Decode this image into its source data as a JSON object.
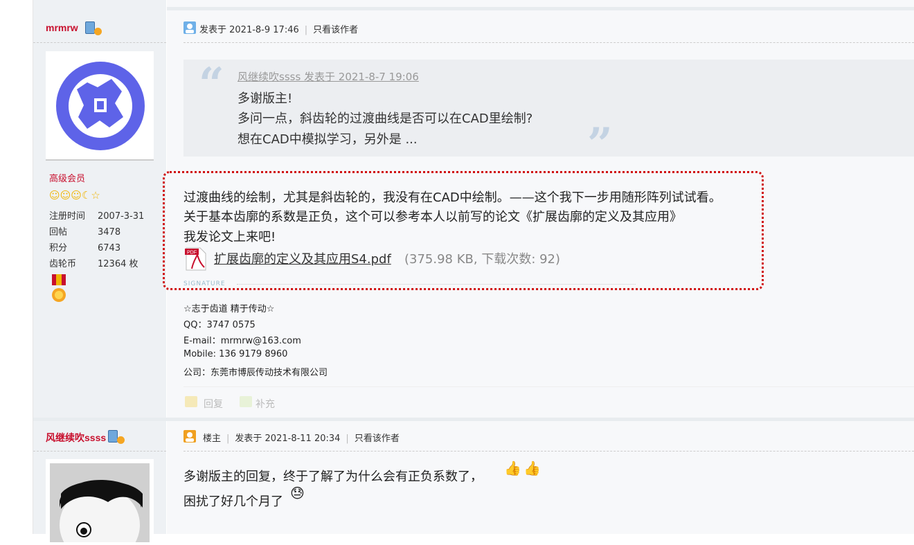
{
  "post1": {
    "username": "mrmrw",
    "rank": "高级会员",
    "stats": [
      {
        "key": "注册时间",
        "value": "2007-3-31"
      },
      {
        "key": "回帖",
        "value": "3478"
      },
      {
        "key": "积分",
        "value": "6743"
      },
      {
        "key": "齿轮币",
        "value": "12364 枚"
      }
    ],
    "posted_at": "发表于 2021-8-9 17:46",
    "only_author": "只看该作者",
    "quote": {
      "header": "风继续吹ssss 发表于 2021-8-7 19:06",
      "lines": [
        "多谢版主!",
        "多问一点，斜齿轮的过渡曲线是否可以在CAD里绘制?",
        "想在CAD中模拟学习，另外是 ..."
      ]
    },
    "body_lines": [
      "过渡曲线的绘制，尤其是斜齿轮的，我没有在CAD中绘制。——这个我下一步用随形阵列试试看。",
      "关于基本齿廓的系数是正负，这个可以参考本人以前写的论文《扩展齿廓的定义及其应用》",
      "我发论文上来吧!"
    ],
    "attachment": {
      "name": "扩展齿廓的定义及其应用S4.pdf",
      "meta": "(375.98 KB, 下载次数: 92)",
      "icon": "pdf-icon"
    },
    "signature_label": "SIGNATURE",
    "signature_lines": [
      "☆志于齿道 精于传动☆",
      "QQ：3747 0575",
      "E-mail：mrmrw@163.com",
      "Mobile: 136 9179 8960",
      "公司：东莞市博辰传动技术有限公司"
    ],
    "actions": {
      "reply": "回复",
      "supplement": "补充"
    }
  },
  "post2": {
    "username": "风继续吹ssss",
    "owner_badge": "楼主",
    "posted_at": "发表于 2021-8-11 20:34",
    "only_author": "只看该作者",
    "body_lines": [
      "多谢版主的回复，终于了解了为什么会有正负系数了，",
      "困扰了好几个月了"
    ]
  },
  "colors": {
    "username": "#c8102e",
    "highlight_border": "#d01010",
    "quote_mark": "#c4d3e3"
  }
}
